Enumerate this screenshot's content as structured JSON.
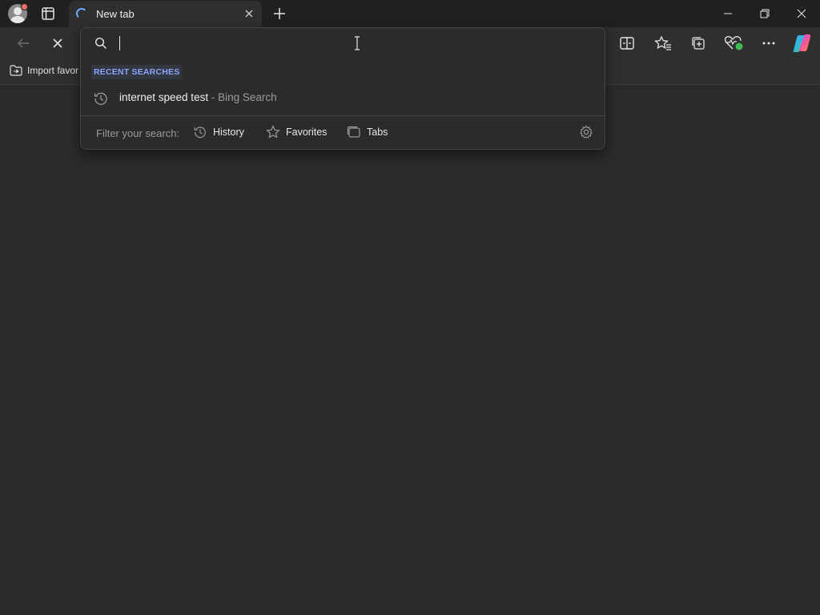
{
  "browser": {
    "tab": {
      "title": "New tab"
    }
  },
  "icons": {
    "profile": "profile-avatar-icon",
    "tab_actions": "tab-actions-icon",
    "new_tab": "plus-icon",
    "minimize": "minimize-icon",
    "restore": "restore-icon",
    "close_window": "close-icon",
    "back": "back-arrow-icon",
    "stop": "stop-icon",
    "split_screen": "split-screen-icon",
    "favorites": "star-list-icon",
    "collections": "collections-icon",
    "performance": "heartbeat-icon",
    "more": "more-icon",
    "copilot": "copilot-icon"
  },
  "favorites_bar": {
    "import_label": "Import favor"
  },
  "omnibox": {
    "input_value": "",
    "recent_label": "RECENT SEARCHES",
    "suggestions": [
      {
        "query": "internet speed test",
        "engine": " - Bing Search"
      }
    ],
    "filter_label": "Filter your search:",
    "filters": [
      {
        "label": "History"
      },
      {
        "label": "Favorites"
      },
      {
        "label": "Tabs"
      }
    ]
  },
  "colors": {
    "accent": "#8aa4ff",
    "background": "#2b2b2b",
    "titlebar": "#202020"
  }
}
